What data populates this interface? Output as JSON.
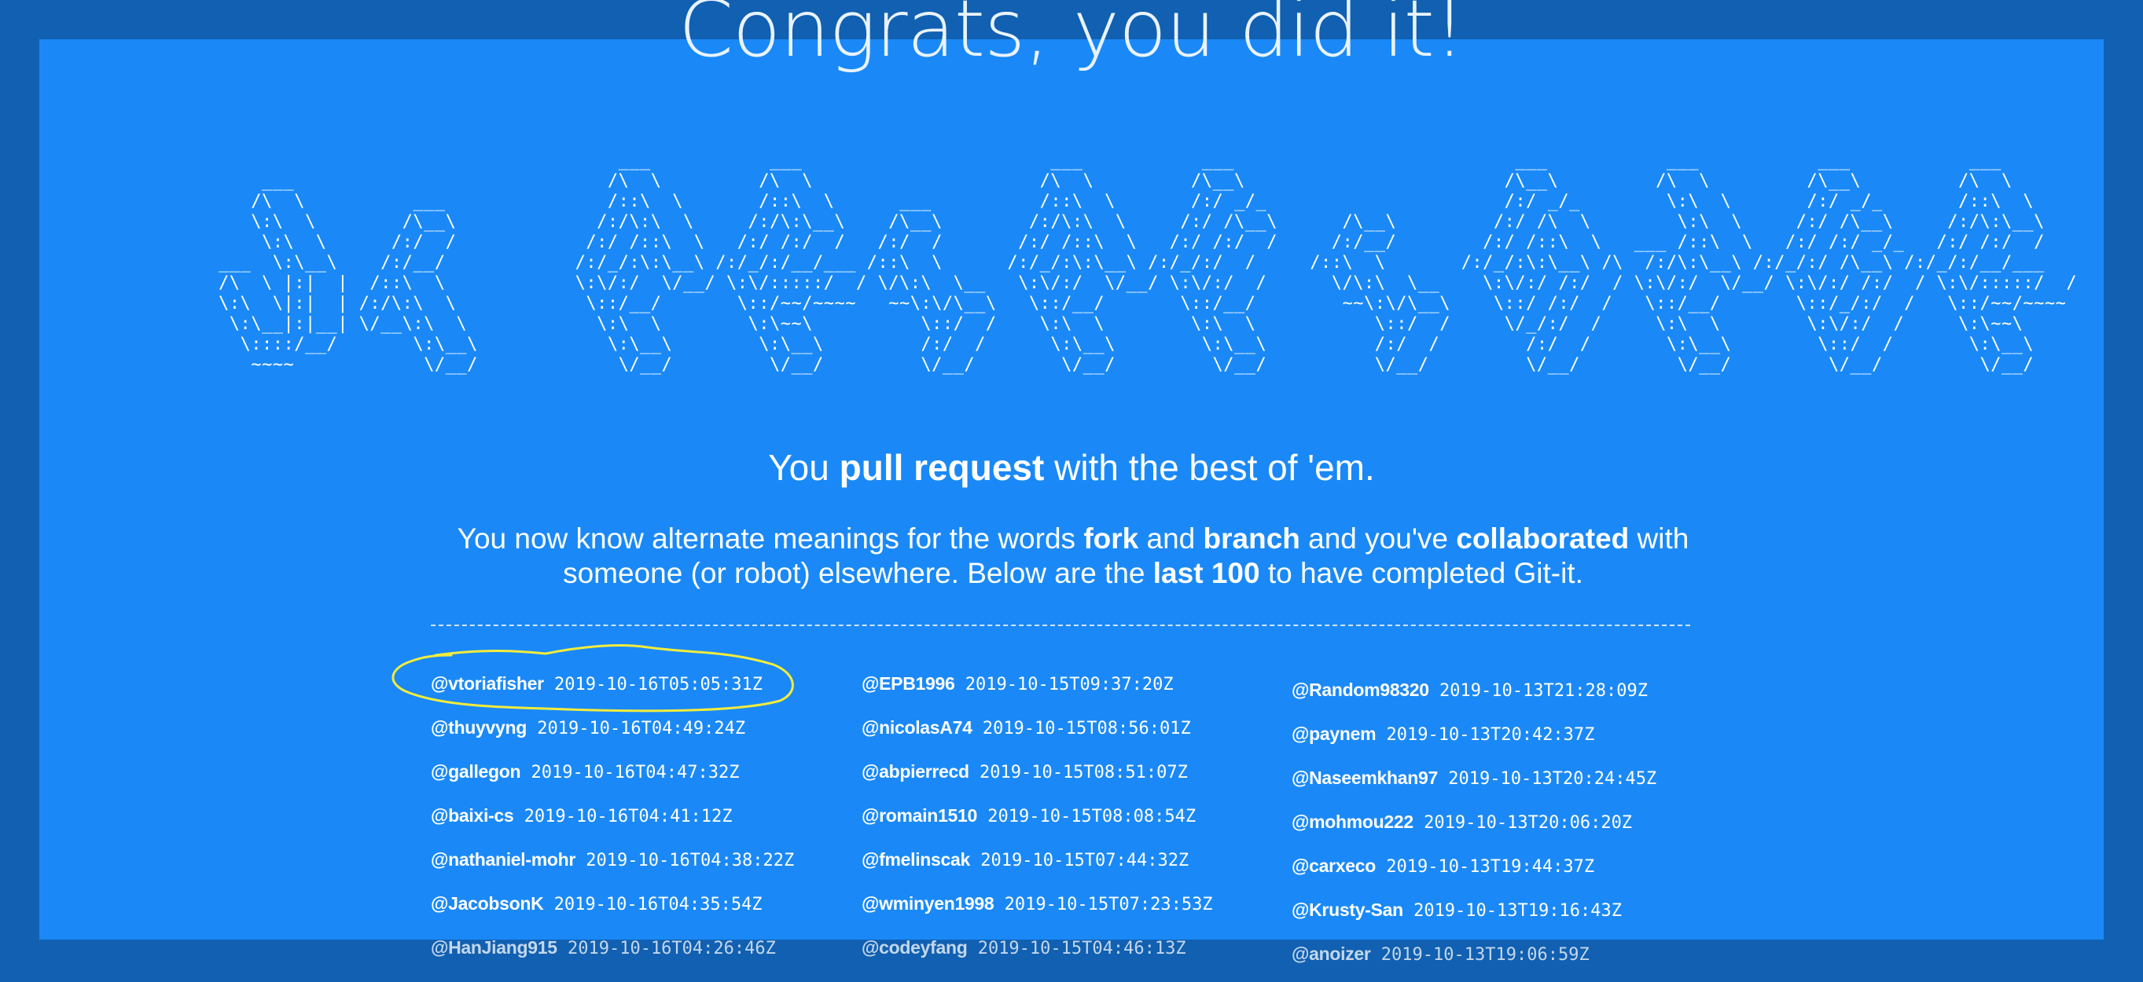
{
  "heading": "Congrats, you did it!",
  "ascii_art": [
    "                                     ___           ___                       ___           ___                          ___           ___           ___           ___     ",
    "    ___                             /\\  \\         /\\  \\                     /\\  \\         /\\__\\                        /\\__\\         /\\  \\         /\\__\\         /\\  \\    ",
    "   /\\  \\          ___               /::\\  \\       /::\\  \\      ___          /::\\  \\       /:/ _/_                      /:/ _/_        \\:\\  \\       /:/ _/_       /::\\  \\   ",
    "   \\:\\  \\        /\\__\\             /:/\\:\\  \\     /:/\\:\\__\\    /\\__\\        /:/\\:\\  \\     /:/ /\\__\\      /\\__\\         /:/ /\\  \\        \\:\\  \\     /:/ /\\__\\     /:/\\:\\__\\  ",
    "    \\:\\  \\      /:/  /            /:/ /::\\  \\   /:/ /:/  /   /:/  /       /:/ /::\\  \\   /:/ /:/  /     /:/__/        /:/ /::\\  \\   ___ /::\\  \\   /:/ /:/ _/_   /:/ /:/  /  ",
    "___  \\:\\__\\    /:/__/            /:/_/:\\:\\__\\ /:/_/:/__/___ /::\\  \\      /:/_/:\\:\\__\\ /:/_/:/  /     /::\\  \\       /:/_/:\\:\\__\\ /\\  /:/\\:\\__\\ /:/_/:/ /\\__\\ /:/_/:/__/___",
    "/\\  \\ |:|  |  /::\\  \\            \\:\\/:/  \\/__/ \\:\\/:::::/  / \\/\\:\\  \\__   \\:\\/:/  \\/__/ \\:\\/:/  /      \\/\\:\\  \\__    \\:\\/:/ /:/  / \\:\\/:/  \\/__/ \\:\\/:/ /:/  / \\:\\/:::::/  /",
    "\\:\\  \\|:|  | /:/\\:\\  \\            \\::/__/       \\::/~~/~~~~   ~~\\:\\/\\__\\   \\::/__/       \\::/__/        ~~\\:\\/\\__\\    \\::/ /:/  /   \\::/__/       \\::/_/:/  /   \\::/~~/~~~~ ",
    " \\:\\__|:|__| \\/__\\:\\  \\            \\:\\  \\        \\:\\~~\\          \\::/  /    \\:\\  \\        \\:\\  \\           \\::/  /     \\/_/:/  /     \\:\\  \\        \\:\\/:/  /     \\:\\~~\\     ",
    "  \\::::/__/       \\:\\__\\            \\:\\__\\        \\:\\__\\         /:/  /      \\:\\__\\        \\:\\__\\          /:/  /        /:/  /       \\:\\__\\        \\::/  /       \\:\\__\\    ",
    "   ~~~~            \\/__/             \\/__/         \\/__/         \\/__/        \\/__/         \\/__/          \\/__/         \\/__/         \\/__/         \\/__/         \\/__/    "
  ],
  "subtitle": {
    "pre": "You ",
    "bold": "pull request",
    "post": " with the best of 'em."
  },
  "blurb": {
    "p1": "You now know alternate meanings for the words ",
    "b1": "fork",
    "p2": " and ",
    "b2": "branch",
    "p3": " and you've ",
    "b3": "collaborated",
    "p4": " with someone (or robot) elsewhere. Below are the ",
    "b4": "last 100",
    "p5": " to have completed Git-it."
  },
  "completers": {
    "col1": [
      {
        "user": "@vtoriafisher",
        "time": "2019-10-16T05:05:31Z"
      },
      {
        "user": "@thuyvyng",
        "time": "2019-10-16T04:49:24Z"
      },
      {
        "user": "@gallegon",
        "time": "2019-10-16T04:47:32Z"
      },
      {
        "user": "@baixi-cs",
        "time": "2019-10-16T04:41:12Z"
      },
      {
        "user": "@nathaniel-mohr",
        "time": "2019-10-16T04:38:22Z"
      },
      {
        "user": "@JacobsonK",
        "time": "2019-10-16T04:35:54Z"
      },
      {
        "user": "@HanJiang915",
        "time": "2019-10-16T04:26:46Z"
      }
    ],
    "col2": [
      {
        "user": "@EPB1996",
        "time": "2019-10-15T09:37:20Z"
      },
      {
        "user": "@nicolasA74",
        "time": "2019-10-15T08:56:01Z"
      },
      {
        "user": "@abpierrecd",
        "time": "2019-10-15T08:51:07Z"
      },
      {
        "user": "@romain1510",
        "time": "2019-10-15T08:08:54Z"
      },
      {
        "user": "@fmelinscak",
        "time": "2019-10-15T07:44:32Z"
      },
      {
        "user": "@wminyen1998",
        "time": "2019-10-15T07:23:53Z"
      },
      {
        "user": "@codeyfang",
        "time": "2019-10-15T04:46:13Z"
      }
    ],
    "col3": [
      {
        "user": "@Random98320",
        "time": "2019-10-13T21:28:09Z"
      },
      {
        "user": "@paynem",
        "time": "2019-10-13T20:42:37Z"
      },
      {
        "user": "@Naseemkhan97",
        "time": "2019-10-13T20:24:45Z"
      },
      {
        "user": "@mohmou222",
        "time": "2019-10-13T20:06:20Z"
      },
      {
        "user": "@carxeco",
        "time": "2019-10-13T19:44:37Z"
      },
      {
        "user": "@Krusty-San",
        "time": "2019-10-13T19:16:43Z"
      },
      {
        "user": "@anoizer",
        "time": "2019-10-13T19:06:59Z"
      }
    ]
  },
  "colors": {
    "page_background": "#1160b1",
    "panel_background": "#1a89f7",
    "highlight_annotation": "#f2ec3c"
  }
}
